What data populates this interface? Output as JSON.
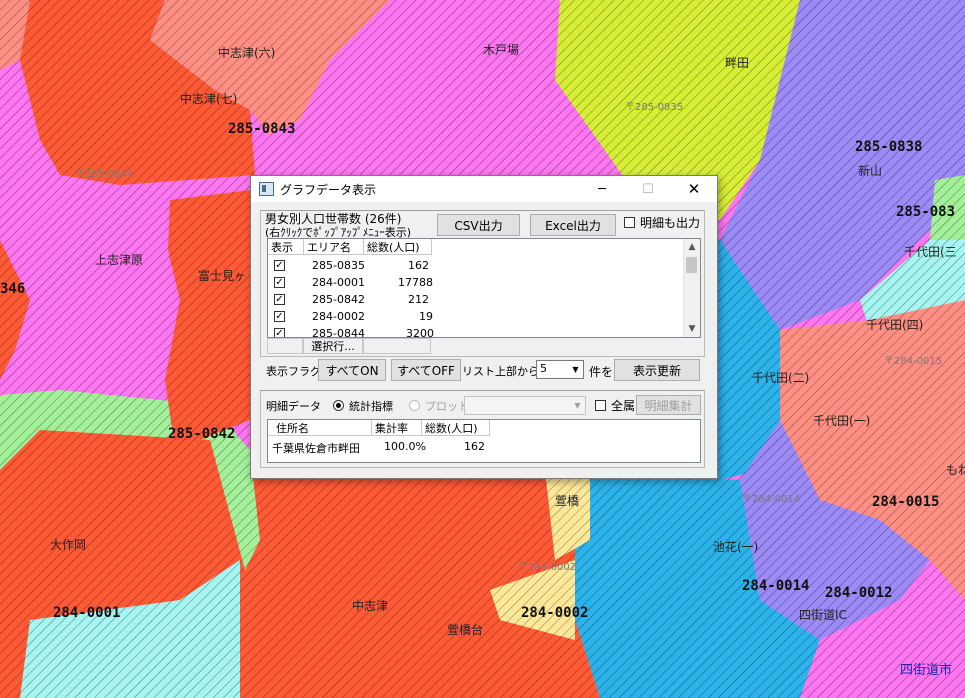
{
  "map": {
    "places": [
      {
        "name": "中志津(六)"
      },
      {
        "name": "木戸場"
      },
      {
        "name": "畔田"
      },
      {
        "name": "中志津(七)"
      },
      {
        "name": "上志津原"
      },
      {
        "name": "富士見ヶ"
      },
      {
        "name": "新山"
      },
      {
        "name": "千代田(三"
      },
      {
        "name": "千代田(四)"
      },
      {
        "name": "千代田(二)"
      },
      {
        "name": "千代田(一)"
      },
      {
        "name": "もね"
      },
      {
        "name": "萱橋"
      },
      {
        "name": "大作岡"
      },
      {
        "name": "池花(一)"
      },
      {
        "name": "中志津"
      },
      {
        "name": "萱橋台"
      },
      {
        "name": "四街道IC"
      },
      {
        "name": "四街道市"
      }
    ],
    "codes": [
      {
        "code": "285-0843"
      },
      {
        "code": "285-0838"
      },
      {
        "code": "285-083"
      },
      {
        "code": "346"
      },
      {
        "code": "285-0842"
      },
      {
        "code": "284-0015"
      },
      {
        "code": "284-0001"
      },
      {
        "code": "284-0002"
      },
      {
        "code": "284-0014"
      },
      {
        "code": "284-0012"
      }
    ],
    "zips": [
      {
        "zip": "〒285-0835"
      },
      {
        "zip": "〒285-0844"
      },
      {
        "zip": "〒284-0015"
      },
      {
        "zip": "〒284-0014"
      },
      {
        "zip": "〒284-0002"
      }
    ]
  },
  "dialog": {
    "title": "グラフデータ表示",
    "controls": {
      "minimize": "─",
      "maximize": "☐",
      "close": "✕"
    },
    "top_group": {
      "heading": "男女別人口世帯数 (26件)",
      "hint": "(右ｸﾘｯｸでﾎﾟｯﾌﾟｱｯﾌﾟﾒﾆｭｰ表示)",
      "csv_button": "CSV出力",
      "excel_button": "Excel出力",
      "detail_output_label": "明細も出力",
      "columns": [
        "表示",
        "エリア名",
        "総数(人口)"
      ],
      "rows": [
        {
          "checked": true,
          "area": "285-0835",
          "total": "162"
        },
        {
          "checked": true,
          "area": "284-0001",
          "total": "17788"
        },
        {
          "checked": true,
          "area": "285-0842",
          "total": "212"
        },
        {
          "checked": true,
          "area": "284-0002",
          "total": "19"
        },
        {
          "checked": true,
          "area": "285-0844",
          "total": "3200"
        }
      ],
      "select_rows_label": "選択行..."
    },
    "flag_row": {
      "label": "表示フラグ",
      "all_on": "すべてON",
      "all_off": "すべてOFF",
      "list_top_label": "リスト上部から",
      "count_value": "5",
      "count_suffix": "件を",
      "refresh": "表示更新"
    },
    "detail_group": {
      "label": "明細データ",
      "stat_radio": "統計指標",
      "plot_radio": "プロット",
      "all_label": "全属",
      "aggregate_button": "明細集計",
      "columns": [
        "住所名",
        "集計率",
        "総数(人口)"
      ],
      "rows": [
        {
          "address": "千葉県佐倉市畔田",
          "rate": "100.0%",
          "total": "162"
        }
      ]
    }
  }
}
